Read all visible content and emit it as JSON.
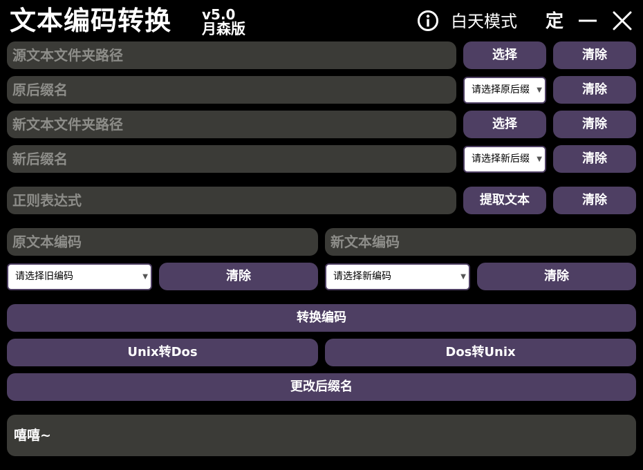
{
  "app": {
    "title": "文本编码转换",
    "version": "v5.0",
    "author": "月森版",
    "mode_label": "白天模式",
    "pin_label": "定"
  },
  "fields": {
    "source_folder": "源文本文件夹路径",
    "old_suffix": "原后缀名",
    "new_folder": "新文本文件夹路径",
    "new_suffix": "新后缀名",
    "regex": "正则表达式",
    "old_encoding": "原文本编码",
    "new_encoding": "新文本编码"
  },
  "buttons": {
    "select": "选择",
    "clear": "清除",
    "extract_text": "提取文本",
    "convert_encoding": "转换编码",
    "unix_to_dos": "Unix转Dos",
    "dos_to_unix": "Dos转Unix",
    "change_suffix": "更改后缀名"
  },
  "selects": {
    "old_suffix": "请选择原后缀",
    "new_suffix": "请选择新后缀",
    "old_encoding": "请选择旧编码",
    "new_encoding": "请选择新编码"
  },
  "log": {
    "text": "嘻嘻~"
  },
  "colors": {
    "background": "#000000",
    "field_bg": "#3b3b37",
    "field_text": "#8d8d89",
    "button_bg": "#4e3f63",
    "button_text": "#ffffff"
  }
}
